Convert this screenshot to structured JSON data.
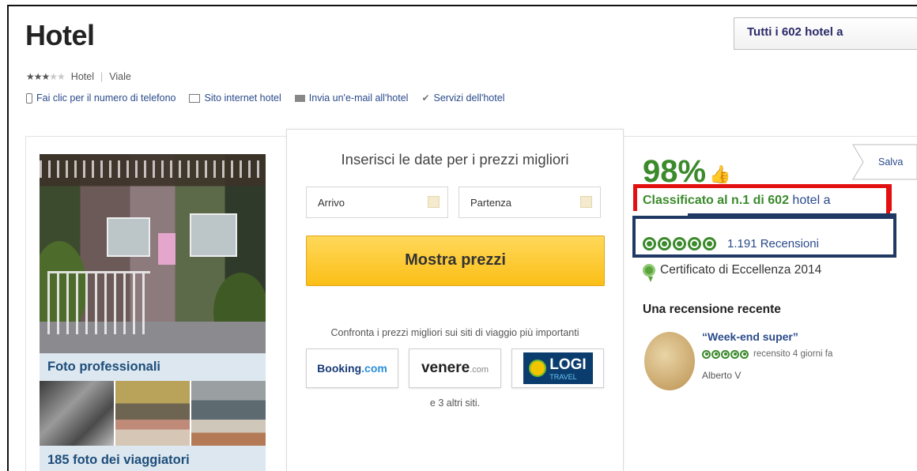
{
  "header": {
    "title": "Hotel",
    "all_hotels_button": "Tutti i 602 hotel a",
    "stars_rating": 3,
    "stars_max": 5,
    "category": "Hotel",
    "street": "Viale"
  },
  "links": [
    {
      "label": "Fai clic per il numero di telefono",
      "icon": "phone-icon"
    },
    {
      "label": "Sito internet hotel",
      "icon": "monitor-icon"
    },
    {
      "label": "Invia un'e-mail all'hotel",
      "icon": "mail-icon"
    },
    {
      "label": "Servizi dell'hotel",
      "icon": "check-icon"
    }
  ],
  "photos": {
    "main_caption": "Foto professionali",
    "travellers_caption": "185 foto dei viaggiatori"
  },
  "booking": {
    "title": "Inserisci le date per i prezzi migliori",
    "checkin_label": "Arrivo",
    "checkout_label": "Partenza",
    "show_prices_button": "Mostra prezzi",
    "compare_text": "Confronta i prezzi migliori sui siti di viaggio più importanti",
    "partners": [
      {
        "name": "Booking",
        "suffix": ".com"
      },
      {
        "name": "venere",
        "suffix": ".com"
      },
      {
        "name": "LOGI",
        "suffix": "TRAVEL"
      }
    ],
    "more_sites": "e 3 altri siti."
  },
  "rating": {
    "score": "98%",
    "save_label": "Salva",
    "ranking_prefix": "Classificato al n.1 di 602",
    "ranking_suffix": "hotel a",
    "bubbles": 5,
    "reviews_count": "1.191 Recensioni",
    "certificate": "Certificato di Eccellenza 2014"
  },
  "recent_review": {
    "section_title": "Una recensione recente",
    "quote": "“Week-end super”",
    "meta": "recensito 4 giorni fa",
    "author": "Alberto V",
    "bubbles": 5
  },
  "colors": {
    "accent_green": "#3b8a2c",
    "link_blue": "#2a4a8a",
    "button_yellow": "#fbbf17",
    "annotation_red": "#e21010",
    "annotation_navy": "#1f3864"
  }
}
